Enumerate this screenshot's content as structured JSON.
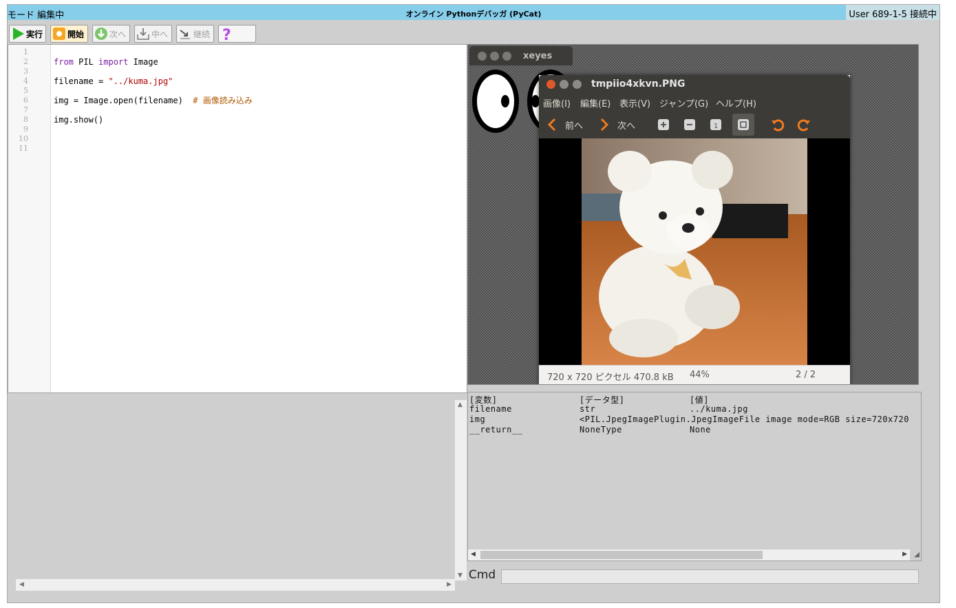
{
  "window": {
    "mode_label": "モード 編集中",
    "title": "オンライン Pythonデバッガ (PyCat)",
    "user_status": "User 689-1-5 接続中"
  },
  "toolbar": {
    "run_label": "実行",
    "start_label": "開始",
    "next_label": "次へ",
    "into_label": "中へ",
    "continue_label": "継続",
    "help_icon": "question-icon"
  },
  "editor": {
    "line_numbers": [
      "1",
      "2",
      "3",
      "4",
      "5",
      "6",
      "7",
      "8",
      "9",
      "10",
      "11"
    ],
    "code": {
      "l2_kw1": "from",
      "l2_mid": " PIL ",
      "l2_kw2": "import",
      "l2_end": " Image",
      "l4_start": "filename = ",
      "l4_str": "\"../kuma.jpg\"",
      "l6_start": "img = Image.open(filename)  ",
      "l6_comment": "# 画像読み込み",
      "l8": "img.show()"
    }
  },
  "xeyes": {
    "title": "xeyes"
  },
  "viewer": {
    "title": "tmpiio4xkvn.PNG",
    "menu": [
      "画像(I)",
      "編集(E)",
      "表示(V)",
      "ジャンプ(G)",
      "ヘルプ(H)"
    ],
    "prev_label": "前へ",
    "next_label": "次へ",
    "status_info": "720 x 720 ピクセル 470.8 kB",
    "zoom": "44%",
    "page": "2 / 2"
  },
  "variables": {
    "headers": [
      "[変数]",
      "[データ型]",
      "[値]"
    ],
    "rows": [
      {
        "name": "filename",
        "type": "str",
        "value": "../kuma.jpg"
      },
      {
        "name": "img",
        "type": "<PIL.JpegImagePlugin.JpegImageFile image mode=RGB size=720x720",
        "value": ""
      },
      {
        "name": "__return__",
        "type": "NoneType",
        "value": "None"
      }
    ]
  },
  "cmd": {
    "label": "Cmd",
    "value": ""
  },
  "colors": {
    "titlebar": "#87ceeb",
    "panel_bg": "#cfcfcf",
    "keyword": "#7a1fa0",
    "string": "#b00000",
    "comment": "#b05800"
  }
}
